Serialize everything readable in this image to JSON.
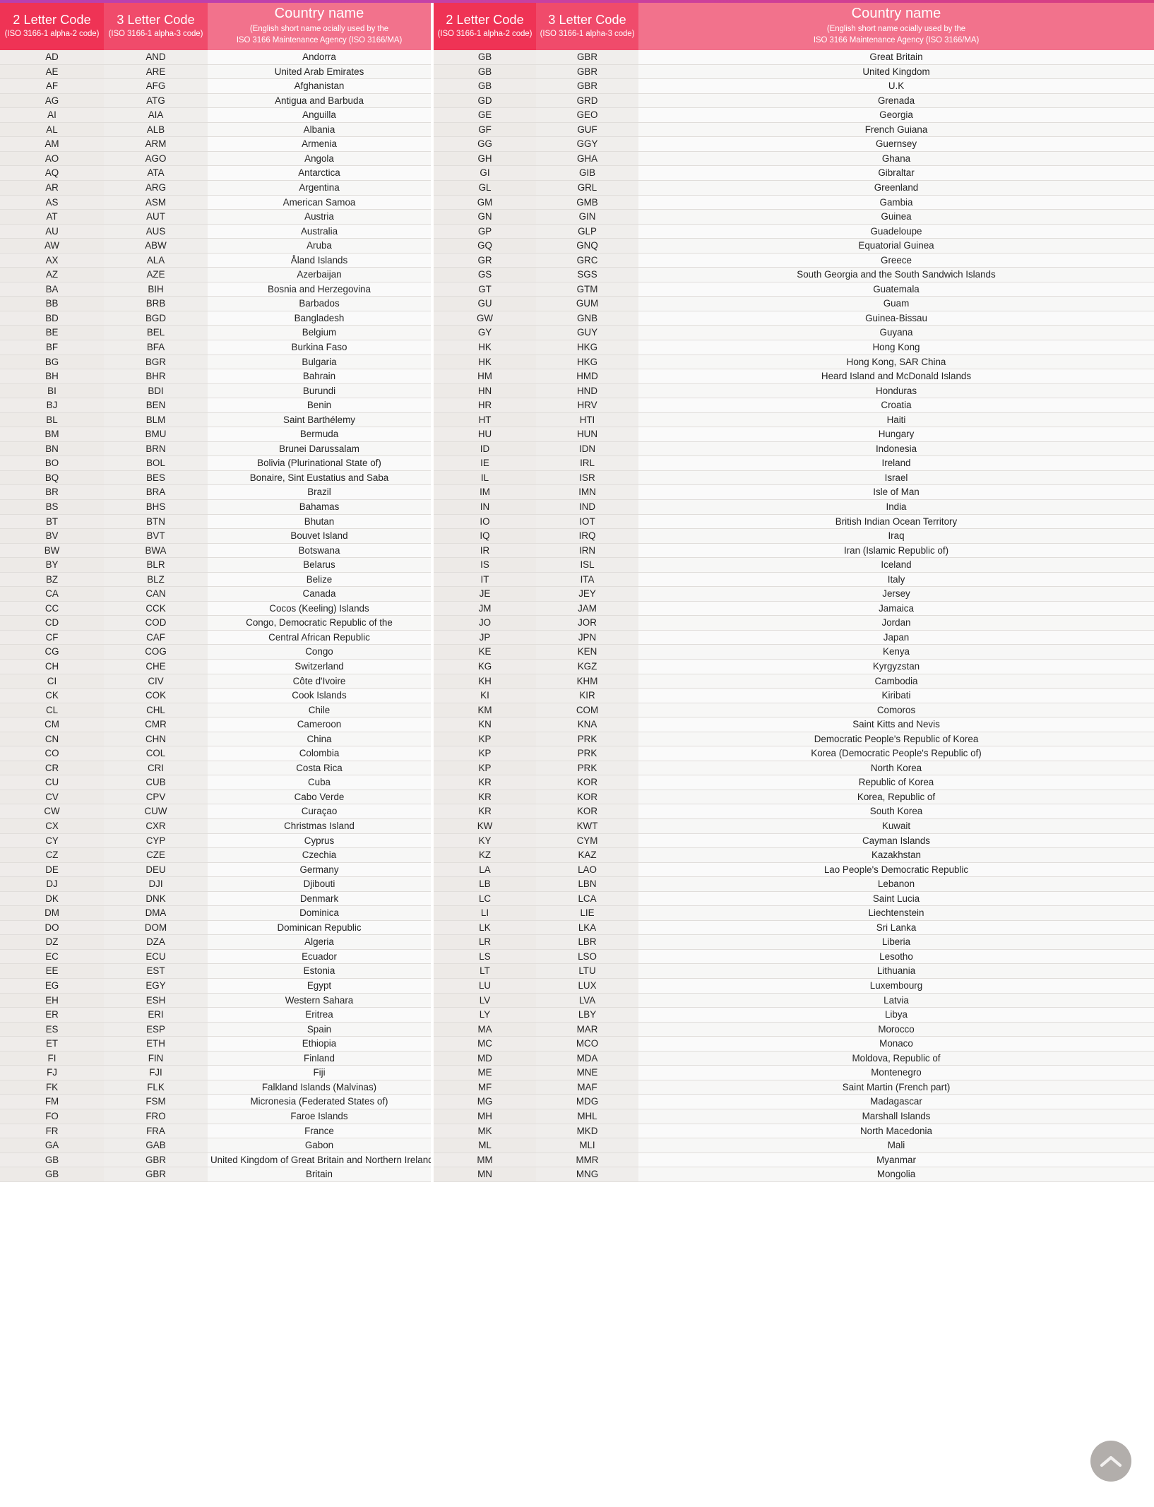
{
  "header": {
    "col2_title": "2 Letter Code",
    "col2_sub": "(ISO 3166-1 alpha-2 code)",
    "col3_title": "3 Letter Code",
    "col3_sub": "(ISO 3166-1 alpha-3 code)",
    "name_title": "Country name",
    "name_sub_line1": "(English short name ocially used by the",
    "name_sub_line2": "ISO 3166 Maintenance Agency (ISO 3166/MA)"
  },
  "colors": {
    "header_code2": "#ef3355",
    "header_code3": "#f04b6b",
    "header_name": "#f2728c",
    "top_rule_start": "#b83fb0",
    "top_rule_end": "#d93f7e",
    "row_code_bg": "#efecea",
    "row_name_bg": "#fafafa",
    "text": "#242424",
    "to_top_bg": "#b2aeab"
  },
  "scroll_to_top": {
    "icon": "chevron-up-icon",
    "label": "Scroll to top"
  },
  "left_table": [
    [
      "AD",
      "AND",
      "Andorra"
    ],
    [
      "AE",
      "ARE",
      "United Arab Emirates"
    ],
    [
      "AF",
      "AFG",
      "Afghanistan"
    ],
    [
      "AG",
      "ATG",
      "Antigua and Barbuda"
    ],
    [
      "AI",
      "AIA",
      "Anguilla"
    ],
    [
      "AL",
      "ALB",
      "Albania"
    ],
    [
      "AM",
      "ARM",
      "Armenia"
    ],
    [
      "AO",
      "AGO",
      "Angola"
    ],
    [
      "AQ",
      "ATA",
      "Antarctica"
    ],
    [
      "AR",
      "ARG",
      "Argentina"
    ],
    [
      "AS",
      "ASM",
      "American Samoa"
    ],
    [
      "AT",
      "AUT",
      "Austria"
    ],
    [
      "AU",
      "AUS",
      "Australia"
    ],
    [
      "AW",
      "ABW",
      "Aruba"
    ],
    [
      "AX",
      "ALA",
      "Åland Islands"
    ],
    [
      "AZ",
      "AZE",
      "Azerbaijan"
    ],
    [
      "BA",
      "BIH",
      "Bosnia and Herzegovina"
    ],
    [
      "BB",
      "BRB",
      "Barbados"
    ],
    [
      "BD",
      "BGD",
      "Bangladesh"
    ],
    [
      "BE",
      "BEL",
      "Belgium"
    ],
    [
      "BF",
      "BFA",
      "Burkina Faso"
    ],
    [
      "BG",
      "BGR",
      "Bulgaria"
    ],
    [
      "BH",
      "BHR",
      "Bahrain"
    ],
    [
      "BI",
      "BDI",
      "Burundi"
    ],
    [
      "BJ",
      "BEN",
      "Benin"
    ],
    [
      "BL",
      "BLM",
      "Saint Barthélemy"
    ],
    [
      "BM",
      "BMU",
      "Bermuda"
    ],
    [
      "BN",
      "BRN",
      "Brunei Darussalam"
    ],
    [
      "BO",
      "BOL",
      "Bolivia (Plurinational State of)"
    ],
    [
      "BQ",
      "BES",
      "Bonaire, Sint Eustatius and Saba"
    ],
    [
      "BR",
      "BRA",
      "Brazil"
    ],
    [
      "BS",
      "BHS",
      "Bahamas"
    ],
    [
      "BT",
      "BTN",
      "Bhutan"
    ],
    [
      "BV",
      "BVT",
      "Bouvet Island"
    ],
    [
      "BW",
      "BWA",
      "Botswana"
    ],
    [
      "BY",
      "BLR",
      "Belarus"
    ],
    [
      "BZ",
      "BLZ",
      "Belize"
    ],
    [
      "CA",
      "CAN",
      "Canada"
    ],
    [
      "CC",
      "CCK",
      "Cocos (Keeling) Islands"
    ],
    [
      "CD",
      "COD",
      "Congo, Democratic Republic of the"
    ],
    [
      "CF",
      "CAF",
      "Central African Republic"
    ],
    [
      "CG",
      "COG",
      "Congo"
    ],
    [
      "CH",
      "CHE",
      "Switzerland"
    ],
    [
      "CI",
      "CIV",
      "Côte d'Ivoire"
    ],
    [
      "CK",
      "COK",
      "Cook Islands"
    ],
    [
      "CL",
      "CHL",
      "Chile"
    ],
    [
      "CM",
      "CMR",
      "Cameroon"
    ],
    [
      "CN",
      "CHN",
      "China"
    ],
    [
      "CO",
      "COL",
      "Colombia"
    ],
    [
      "CR",
      "CRI",
      "Costa Rica"
    ],
    [
      "CU",
      "CUB",
      "Cuba"
    ],
    [
      "CV",
      "CPV",
      "Cabo Verde"
    ],
    [
      "CW",
      "CUW",
      "Curaçao"
    ],
    [
      "CX",
      "CXR",
      "Christmas Island"
    ],
    [
      "CY",
      "CYP",
      "Cyprus"
    ],
    [
      "CZ",
      "CZE",
      "Czechia"
    ],
    [
      "DE",
      "DEU",
      "Germany"
    ],
    [
      "DJ",
      "DJI",
      "Djibouti"
    ],
    [
      "DK",
      "DNK",
      "Denmark"
    ],
    [
      "DM",
      "DMA",
      "Dominica"
    ],
    [
      "DO",
      "DOM",
      "Dominican Republic"
    ],
    [
      "DZ",
      "DZA",
      "Algeria"
    ],
    [
      "EC",
      "ECU",
      "Ecuador"
    ],
    [
      "EE",
      "EST",
      "Estonia"
    ],
    [
      "EG",
      "EGY",
      "Egypt"
    ],
    [
      "EH",
      "ESH",
      "Western Sahara"
    ],
    [
      "ER",
      "ERI",
      "Eritrea"
    ],
    [
      "ES",
      "ESP",
      "Spain"
    ],
    [
      "ET",
      "ETH",
      "Ethiopia"
    ],
    [
      "FI",
      "FIN",
      "Finland"
    ],
    [
      "FJ",
      "FJI",
      "Fiji"
    ],
    [
      "FK",
      "FLK",
      "Falkland Islands (Malvinas)"
    ],
    [
      "FM",
      "FSM",
      "Micronesia (Federated States of)"
    ],
    [
      "FO",
      "FRO",
      "Faroe Islands"
    ],
    [
      "FR",
      "FRA",
      "France"
    ],
    [
      "GA",
      "GAB",
      "Gabon"
    ],
    [
      "GB",
      "GBR",
      "United Kingdom of Great Britain and Northern Ireland"
    ],
    [
      "GB",
      "GBR",
      "Britain"
    ]
  ],
  "right_table": [
    [
      "GB",
      "GBR",
      "Great Britain"
    ],
    [
      "GB",
      "GBR",
      "United Kingdom"
    ],
    [
      "GB",
      "GBR",
      "U.K"
    ],
    [
      "GD",
      "GRD",
      "Grenada"
    ],
    [
      "GE",
      "GEO",
      "Georgia"
    ],
    [
      "GF",
      "GUF",
      "French Guiana"
    ],
    [
      "GG",
      "GGY",
      "Guernsey"
    ],
    [
      "GH",
      "GHA",
      "Ghana"
    ],
    [
      "GI",
      "GIB",
      "Gibraltar"
    ],
    [
      "GL",
      "GRL",
      "Greenland"
    ],
    [
      "GM",
      "GMB",
      "Gambia"
    ],
    [
      "GN",
      "GIN",
      "Guinea"
    ],
    [
      "GP",
      "GLP",
      "Guadeloupe"
    ],
    [
      "GQ",
      "GNQ",
      "Equatorial Guinea"
    ],
    [
      "GR",
      "GRC",
      "Greece"
    ],
    [
      "GS",
      "SGS",
      "South Georgia and the South Sandwich Islands"
    ],
    [
      "GT",
      "GTM",
      "Guatemala"
    ],
    [
      "GU",
      "GUM",
      "Guam"
    ],
    [
      "GW",
      "GNB",
      "Guinea-Bissau"
    ],
    [
      "GY",
      "GUY",
      "Guyana"
    ],
    [
      "HK",
      "HKG",
      "Hong Kong"
    ],
    [
      "HK",
      "HKG",
      "Hong Kong, SAR China"
    ],
    [
      "HM",
      "HMD",
      "Heard Island and McDonald Islands"
    ],
    [
      "HN",
      "HND",
      "Honduras"
    ],
    [
      "HR",
      "HRV",
      "Croatia"
    ],
    [
      "HT",
      "HTI",
      "Haiti"
    ],
    [
      "HU",
      "HUN",
      "Hungary"
    ],
    [
      "ID",
      "IDN",
      "Indonesia"
    ],
    [
      "IE",
      "IRL",
      "Ireland"
    ],
    [
      "IL",
      "ISR",
      "Israel"
    ],
    [
      "IM",
      "IMN",
      "Isle of Man"
    ],
    [
      "IN",
      "IND",
      "India"
    ],
    [
      "IO",
      "IOT",
      "British Indian Ocean Territory"
    ],
    [
      "IQ",
      "IRQ",
      "Iraq"
    ],
    [
      "IR",
      "IRN",
      "Iran (Islamic Republic of)"
    ],
    [
      "IS",
      "ISL",
      "Iceland"
    ],
    [
      "IT",
      "ITA",
      "Italy"
    ],
    [
      "JE",
      "JEY",
      "Jersey"
    ],
    [
      "JM",
      "JAM",
      "Jamaica"
    ],
    [
      "JO",
      "JOR",
      "Jordan"
    ],
    [
      "JP",
      "JPN",
      "Japan"
    ],
    [
      "KE",
      "KEN",
      "Kenya"
    ],
    [
      "KG",
      "KGZ",
      "Kyrgyzstan"
    ],
    [
      "KH",
      "KHM",
      "Cambodia"
    ],
    [
      "KI",
      "KIR",
      "Kiribati"
    ],
    [
      "KM",
      "COM",
      "Comoros"
    ],
    [
      "KN",
      "KNA",
      "Saint Kitts and Nevis"
    ],
    [
      "KP",
      "PRK",
      "Democratic People's Republic of Korea"
    ],
    [
      "KP",
      "PRK",
      "Korea (Democratic People's Republic of)"
    ],
    [
      "KP",
      "PRK",
      "North Korea"
    ],
    [
      "KR",
      "KOR",
      "Republic of Korea"
    ],
    [
      "KR",
      "KOR",
      "Korea, Republic of"
    ],
    [
      "KR",
      "KOR",
      "South Korea"
    ],
    [
      "KW",
      "KWT",
      "Kuwait"
    ],
    [
      "KY",
      "CYM",
      "Cayman Islands"
    ],
    [
      "KZ",
      "KAZ",
      "Kazakhstan"
    ],
    [
      "LA",
      "LAO",
      "Lao People's Democratic Republic"
    ],
    [
      "LB",
      "LBN",
      "Lebanon"
    ],
    [
      "LC",
      "LCA",
      "Saint Lucia"
    ],
    [
      "LI",
      "LIE",
      "Liechtenstein"
    ],
    [
      "LK",
      "LKA",
      "Sri Lanka"
    ],
    [
      "LR",
      "LBR",
      "Liberia"
    ],
    [
      "LS",
      "LSO",
      "Lesotho"
    ],
    [
      "LT",
      "LTU",
      "Lithuania"
    ],
    [
      "LU",
      "LUX",
      "Luxembourg"
    ],
    [
      "LV",
      "LVA",
      "Latvia"
    ],
    [
      "LY",
      "LBY",
      "Libya"
    ],
    [
      "MA",
      "MAR",
      "Morocco"
    ],
    [
      "MC",
      "MCO",
      "Monaco"
    ],
    [
      "MD",
      "MDA",
      "Moldova, Republic of"
    ],
    [
      "ME",
      "MNE",
      "Montenegro"
    ],
    [
      "MF",
      "MAF",
      "Saint Martin (French part)"
    ],
    [
      "MG",
      "MDG",
      "Madagascar"
    ],
    [
      "MH",
      "MHL",
      "Marshall Islands"
    ],
    [
      "MK",
      "MKD",
      "North Macedonia"
    ],
    [
      "ML",
      "MLI",
      "Mali"
    ],
    [
      "MM",
      "MMR",
      "Myanmar"
    ],
    [
      "MN",
      "MNG",
      "Mongolia"
    ]
  ]
}
